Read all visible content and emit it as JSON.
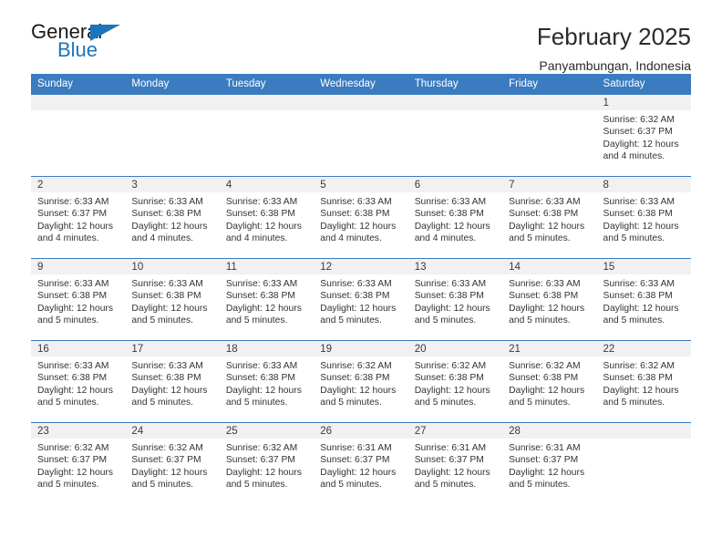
{
  "logo": {
    "primary_text": "General",
    "secondary_text": "Blue",
    "triangle_color": "#1c75bc"
  },
  "header": {
    "title": "February 2025",
    "subtitle": "Panyambungan, Indonesia"
  },
  "calendar": {
    "accent_color": "#3b7cc0",
    "daynum_band_color": "#f1f1f1",
    "weekdays": [
      "Sunday",
      "Monday",
      "Tuesday",
      "Wednesday",
      "Thursday",
      "Friday",
      "Saturday"
    ],
    "weeks": [
      [
        {
          "day": "",
          "empty": true
        },
        {
          "day": "",
          "empty": true
        },
        {
          "day": "",
          "empty": true
        },
        {
          "day": "",
          "empty": true
        },
        {
          "day": "",
          "empty": true
        },
        {
          "day": "",
          "empty": true
        },
        {
          "day": "1",
          "sunrise": "Sunrise: 6:32 AM",
          "sunset": "Sunset: 6:37 PM",
          "daylight_line1": "Daylight: 12 hours",
          "daylight_line2": "and 4 minutes."
        }
      ],
      [
        {
          "day": "2",
          "sunrise": "Sunrise: 6:33 AM",
          "sunset": "Sunset: 6:37 PM",
          "daylight_line1": "Daylight: 12 hours",
          "daylight_line2": "and 4 minutes."
        },
        {
          "day": "3",
          "sunrise": "Sunrise: 6:33 AM",
          "sunset": "Sunset: 6:38 PM",
          "daylight_line1": "Daylight: 12 hours",
          "daylight_line2": "and 4 minutes."
        },
        {
          "day": "4",
          "sunrise": "Sunrise: 6:33 AM",
          "sunset": "Sunset: 6:38 PM",
          "daylight_line1": "Daylight: 12 hours",
          "daylight_line2": "and 4 minutes."
        },
        {
          "day": "5",
          "sunrise": "Sunrise: 6:33 AM",
          "sunset": "Sunset: 6:38 PM",
          "daylight_line1": "Daylight: 12 hours",
          "daylight_line2": "and 4 minutes."
        },
        {
          "day": "6",
          "sunrise": "Sunrise: 6:33 AM",
          "sunset": "Sunset: 6:38 PM",
          "daylight_line1": "Daylight: 12 hours",
          "daylight_line2": "and 4 minutes."
        },
        {
          "day": "7",
          "sunrise": "Sunrise: 6:33 AM",
          "sunset": "Sunset: 6:38 PM",
          "daylight_line1": "Daylight: 12 hours",
          "daylight_line2": "and 5 minutes."
        },
        {
          "day": "8",
          "sunrise": "Sunrise: 6:33 AM",
          "sunset": "Sunset: 6:38 PM",
          "daylight_line1": "Daylight: 12 hours",
          "daylight_line2": "and 5 minutes."
        }
      ],
      [
        {
          "day": "9",
          "sunrise": "Sunrise: 6:33 AM",
          "sunset": "Sunset: 6:38 PM",
          "daylight_line1": "Daylight: 12 hours",
          "daylight_line2": "and 5 minutes."
        },
        {
          "day": "10",
          "sunrise": "Sunrise: 6:33 AM",
          "sunset": "Sunset: 6:38 PM",
          "daylight_line1": "Daylight: 12 hours",
          "daylight_line2": "and 5 minutes."
        },
        {
          "day": "11",
          "sunrise": "Sunrise: 6:33 AM",
          "sunset": "Sunset: 6:38 PM",
          "daylight_line1": "Daylight: 12 hours",
          "daylight_line2": "and 5 minutes."
        },
        {
          "day": "12",
          "sunrise": "Sunrise: 6:33 AM",
          "sunset": "Sunset: 6:38 PM",
          "daylight_line1": "Daylight: 12 hours",
          "daylight_line2": "and 5 minutes."
        },
        {
          "day": "13",
          "sunrise": "Sunrise: 6:33 AM",
          "sunset": "Sunset: 6:38 PM",
          "daylight_line1": "Daylight: 12 hours",
          "daylight_line2": "and 5 minutes."
        },
        {
          "day": "14",
          "sunrise": "Sunrise: 6:33 AM",
          "sunset": "Sunset: 6:38 PM",
          "daylight_line1": "Daylight: 12 hours",
          "daylight_line2": "and 5 minutes."
        },
        {
          "day": "15",
          "sunrise": "Sunrise: 6:33 AM",
          "sunset": "Sunset: 6:38 PM",
          "daylight_line1": "Daylight: 12 hours",
          "daylight_line2": "and 5 minutes."
        }
      ],
      [
        {
          "day": "16",
          "sunrise": "Sunrise: 6:33 AM",
          "sunset": "Sunset: 6:38 PM",
          "daylight_line1": "Daylight: 12 hours",
          "daylight_line2": "and 5 minutes."
        },
        {
          "day": "17",
          "sunrise": "Sunrise: 6:33 AM",
          "sunset": "Sunset: 6:38 PM",
          "daylight_line1": "Daylight: 12 hours",
          "daylight_line2": "and 5 minutes."
        },
        {
          "day": "18",
          "sunrise": "Sunrise: 6:33 AM",
          "sunset": "Sunset: 6:38 PM",
          "daylight_line1": "Daylight: 12 hours",
          "daylight_line2": "and 5 minutes."
        },
        {
          "day": "19",
          "sunrise": "Sunrise: 6:32 AM",
          "sunset": "Sunset: 6:38 PM",
          "daylight_line1": "Daylight: 12 hours",
          "daylight_line2": "and 5 minutes."
        },
        {
          "day": "20",
          "sunrise": "Sunrise: 6:32 AM",
          "sunset": "Sunset: 6:38 PM",
          "daylight_line1": "Daylight: 12 hours",
          "daylight_line2": "and 5 minutes."
        },
        {
          "day": "21",
          "sunrise": "Sunrise: 6:32 AM",
          "sunset": "Sunset: 6:38 PM",
          "daylight_line1": "Daylight: 12 hours",
          "daylight_line2": "and 5 minutes."
        },
        {
          "day": "22",
          "sunrise": "Sunrise: 6:32 AM",
          "sunset": "Sunset: 6:38 PM",
          "daylight_line1": "Daylight: 12 hours",
          "daylight_line2": "and 5 minutes."
        }
      ],
      [
        {
          "day": "23",
          "sunrise": "Sunrise: 6:32 AM",
          "sunset": "Sunset: 6:37 PM",
          "daylight_line1": "Daylight: 12 hours",
          "daylight_line2": "and 5 minutes."
        },
        {
          "day": "24",
          "sunrise": "Sunrise: 6:32 AM",
          "sunset": "Sunset: 6:37 PM",
          "daylight_line1": "Daylight: 12 hours",
          "daylight_line2": "and 5 minutes."
        },
        {
          "day": "25",
          "sunrise": "Sunrise: 6:32 AM",
          "sunset": "Sunset: 6:37 PM",
          "daylight_line1": "Daylight: 12 hours",
          "daylight_line2": "and 5 minutes."
        },
        {
          "day": "26",
          "sunrise": "Sunrise: 6:31 AM",
          "sunset": "Sunset: 6:37 PM",
          "daylight_line1": "Daylight: 12 hours",
          "daylight_line2": "and 5 minutes."
        },
        {
          "day": "27",
          "sunrise": "Sunrise: 6:31 AM",
          "sunset": "Sunset: 6:37 PM",
          "daylight_line1": "Daylight: 12 hours",
          "daylight_line2": "and 5 minutes."
        },
        {
          "day": "28",
          "sunrise": "Sunrise: 6:31 AM",
          "sunset": "Sunset: 6:37 PM",
          "daylight_line1": "Daylight: 12 hours",
          "daylight_line2": "and 5 minutes."
        },
        {
          "day": "",
          "empty": true
        }
      ]
    ]
  }
}
